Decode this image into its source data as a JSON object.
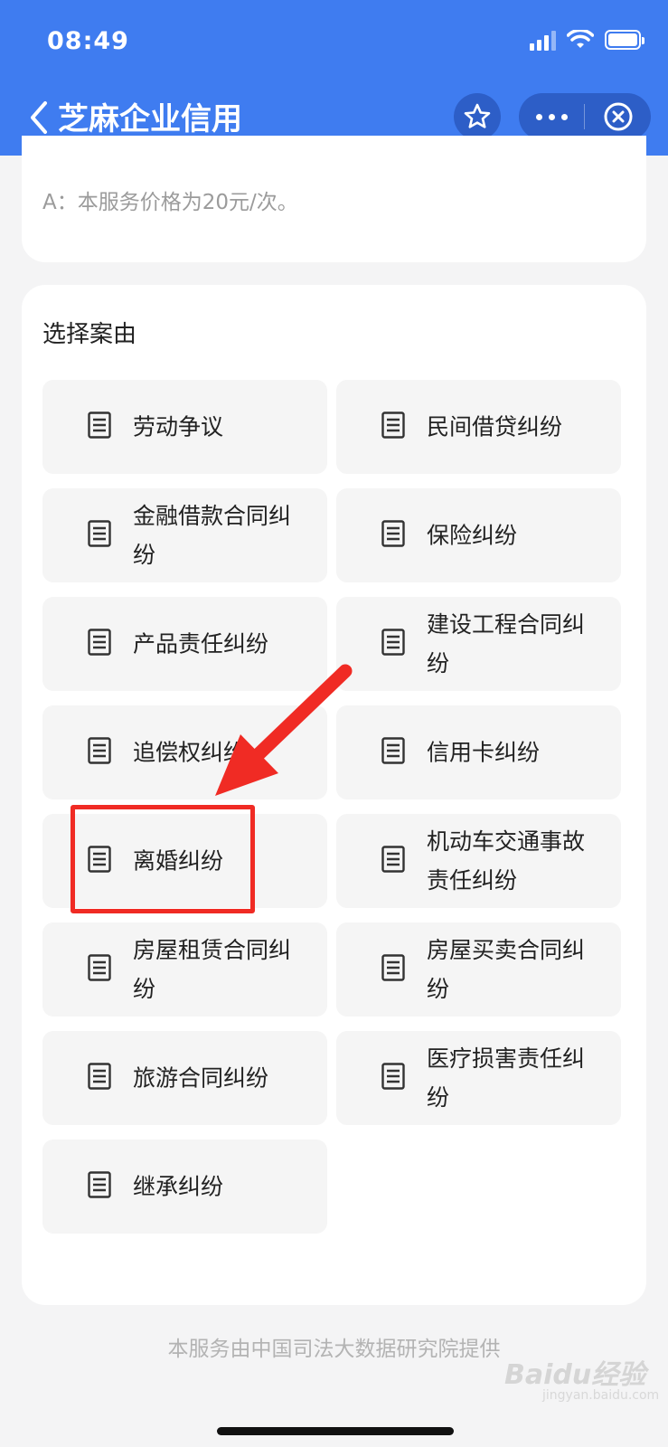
{
  "status_bar": {
    "time": "08:49"
  },
  "nav": {
    "title": "芝麻企业信用"
  },
  "faq": {
    "answer": "A：本服务价格为20元/次。"
  },
  "section": {
    "title": "选择案由",
    "items": [
      {
        "label": "劳动争议"
      },
      {
        "label": "民间借贷纠纷"
      },
      {
        "label": "金融借款合同纠纷"
      },
      {
        "label": "保险纠纷"
      },
      {
        "label": "产品责任纠纷"
      },
      {
        "label": "建设工程合同纠纷"
      },
      {
        "label": "追偿权纠纷"
      },
      {
        "label": "信用卡纠纷"
      },
      {
        "label": "离婚纠纷"
      },
      {
        "label": "机动车交通事故责任纠纷"
      },
      {
        "label": "房屋租赁合同纠纷"
      },
      {
        "label": "房屋买卖合同纠纷"
      },
      {
        "label": "旅游合同纠纷"
      },
      {
        "label": "医疗损害责任纠纷"
      },
      {
        "label": "继承纠纷"
      }
    ]
  },
  "footer": {
    "text": "本服务由中国司法大数据研究院提供"
  },
  "watermark": {
    "text": "Baidu经验",
    "sub": "jingyan.baidu.com"
  },
  "colors": {
    "header": "#3f7cf0",
    "annotation": "#f02b24"
  },
  "icons": [
    "chevron-left-icon",
    "star-icon",
    "more-icon",
    "close-icon",
    "document-icon",
    "wifi-icon",
    "signal-icon",
    "battery-icon"
  ]
}
